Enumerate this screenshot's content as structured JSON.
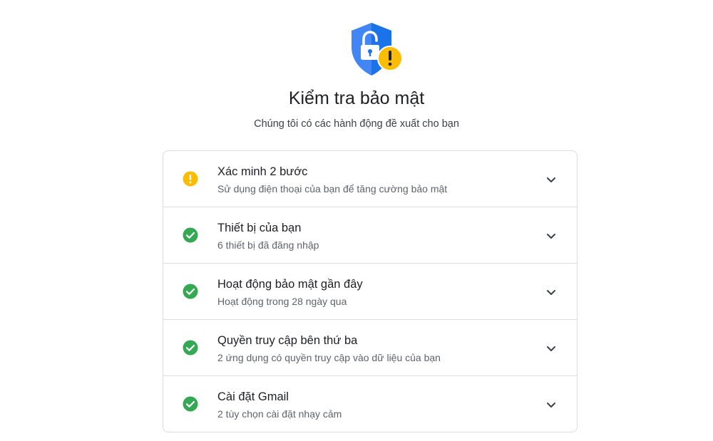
{
  "header": {
    "title": "Kiểm tra bảo mật",
    "subtitle": "Chúng tôi có các hành động đề xuất cho bạn"
  },
  "colors": {
    "shield": "#4285f4",
    "warning": "#fbbc04",
    "success": "#34a853",
    "divider": "#dadce0"
  },
  "items": [
    {
      "title": "Xác minh 2 bước",
      "subtitle": "Sử dụng điện thoại của bạn để tăng cường bảo mật",
      "status": "warning-icon"
    },
    {
      "title": "Thiết bị của bạn",
      "subtitle": "6 thiết bị đã đăng nhập",
      "status": "check-circle-icon"
    },
    {
      "title": "Hoạt động bảo mật gần đây",
      "subtitle": "Hoạt động trong 28 ngày qua",
      "status": "check-circle-icon"
    },
    {
      "title": "Quyền truy cập bên thứ ba",
      "subtitle": "2 ứng dụng có quyền truy cập vào dữ liệu của bạn",
      "status": "check-circle-icon"
    },
    {
      "title": "Cài đặt Gmail",
      "subtitle": "2 tùy chọn cài đặt nhạy cảm",
      "status": "check-circle-icon"
    }
  ]
}
